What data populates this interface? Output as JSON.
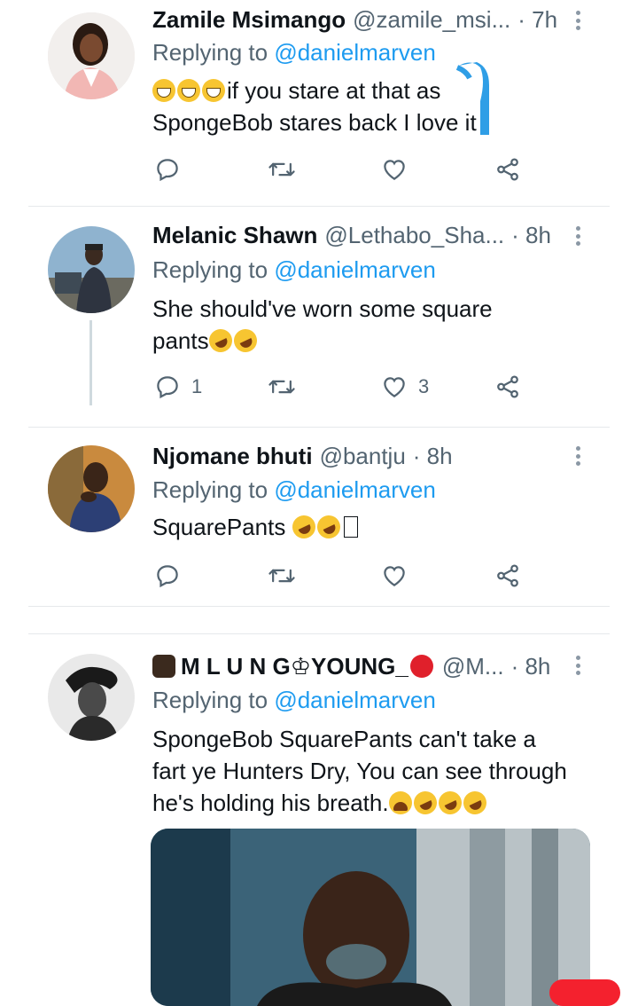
{
  "tweets": [
    {
      "name": "Zamile Msimango",
      "handle": "@zamile_msi...",
      "time": "· 7h",
      "reply_prefix": "Replying to",
      "reply_to": "@danielmarven",
      "line1": "if you stare at that as",
      "line2": "SpongeBob stares back I love it",
      "reply_count": "",
      "retweet_count": "",
      "like_count": ""
    },
    {
      "name": "Melanic Shawn",
      "handle": "@Lethabo_Sha...",
      "time": "· 8h",
      "reply_prefix": "Replying to",
      "reply_to": "@danielmarven",
      "line1": "She should've worn some square",
      "line2": "pants",
      "reply_count": "1",
      "retweet_count": "",
      "like_count": "3"
    },
    {
      "name": "Njomane bhuti",
      "handle": "@bantju",
      "time": "· 8h",
      "reply_prefix": "Replying to",
      "reply_to": "@danielmarven",
      "line1": "SquarePants",
      "reply_count": "",
      "retweet_count": "",
      "like_count": ""
    },
    {
      "name": "M L U N G♔YOUNG_",
      "handle": "@M...",
      "time": "· 8h",
      "reply_prefix": "Replying to",
      "reply_to": "@danielmarven",
      "line1": "SpongeBob SquarePants can't take a",
      "line2": "fart ye Hunters Dry, You can see through",
      "line3": "he's holding his breath."
    }
  ],
  "icons": {
    "reply": "reply-icon",
    "retweet": "retweet-icon",
    "like": "heart-icon",
    "share": "share-icon",
    "more": "more-icon"
  },
  "colors": {
    "accent": "#1d9bf0",
    "secondary_text": "#536471",
    "divider": "#e6e9eb"
  }
}
